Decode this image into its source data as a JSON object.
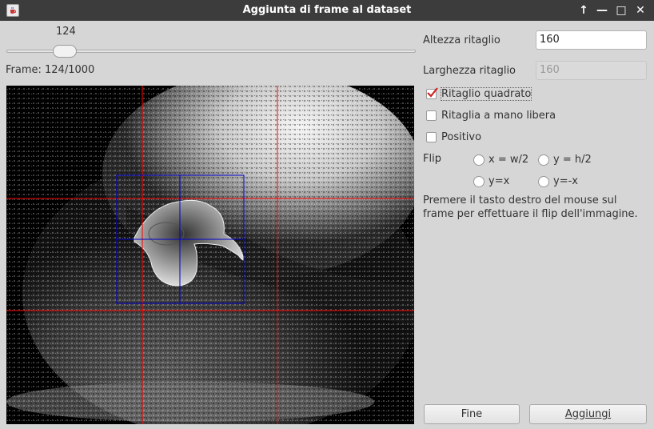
{
  "window": {
    "title": "Aggiunta di frame al dataset",
    "icon": "java-cup-icon",
    "controls": {
      "maximize_up": "↑",
      "minimize": "—",
      "maximize": "□",
      "close": "✕"
    }
  },
  "slider": {
    "value_label": "124",
    "value": 124,
    "max": 1000
  },
  "frame_label": "Frame: 124/1000",
  "crop": {
    "height_label": "Altezza ritaglio",
    "height_value": "160",
    "width_label": "Larghezza ritaglio",
    "width_value": "160",
    "width_disabled": true
  },
  "options": {
    "square_crop": {
      "label": "Ritaglio quadrato",
      "checked": true
    },
    "freehand_crop": {
      "label": "Ritaglia a mano libera",
      "checked": false
    },
    "positive": {
      "label": "Positivo",
      "checked": false
    }
  },
  "flip": {
    "label": "Flip",
    "options": [
      "x = w/2",
      "y = h/2",
      "y=x",
      "y=-x"
    ]
  },
  "hint": "Premere il tasto destro del mouse sul frame per effettuare il flip dell'immagine.",
  "buttons": {
    "finish": "Fine",
    "add": "Aggiungi"
  },
  "colors": {
    "guide_lines": "#ff0000",
    "crop_box": "#0000cc",
    "check_mark": "#cc2222"
  }
}
